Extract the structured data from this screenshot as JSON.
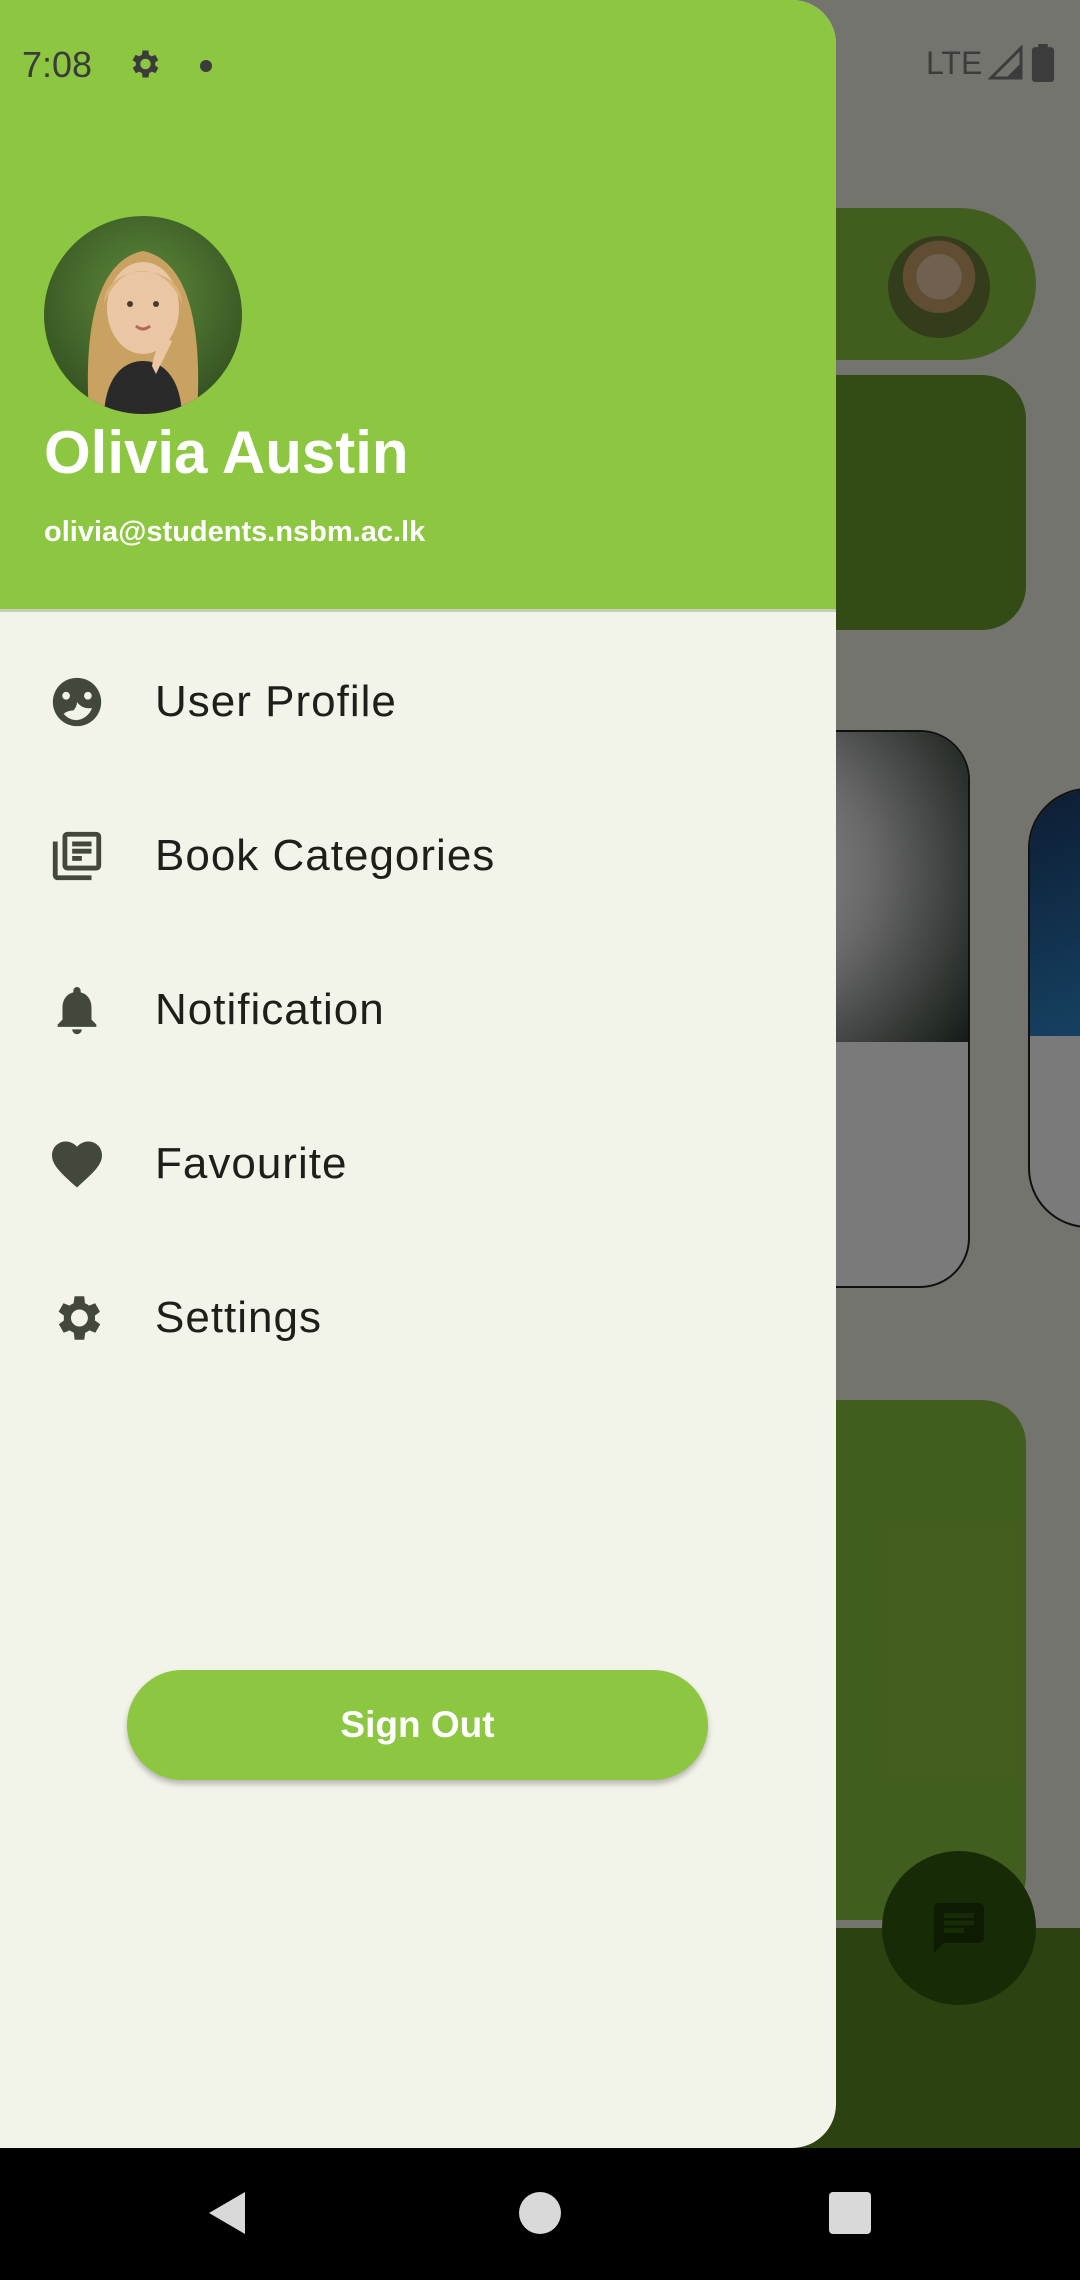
{
  "status_bar": {
    "time": "7:08",
    "network": "LTE"
  },
  "user": {
    "name": "Olivia Austin",
    "email": "olivia@students.nsbm.ac.lk"
  },
  "menu": {
    "items": [
      {
        "label": "User Profile",
        "icon": "face-icon"
      },
      {
        "label": "Book Categories",
        "icon": "library-books-icon"
      },
      {
        "label": "Notification",
        "icon": "bell-icon"
      },
      {
        "label": "Favourite",
        "icon": "heart-icon"
      },
      {
        "label": "Settings",
        "icon": "gear-icon"
      }
    ]
  },
  "sign_out_label": "Sign Out",
  "colors": {
    "accent": "#8dc641",
    "icon": "#43493a",
    "drawer_bg": "#f2f3e9"
  }
}
